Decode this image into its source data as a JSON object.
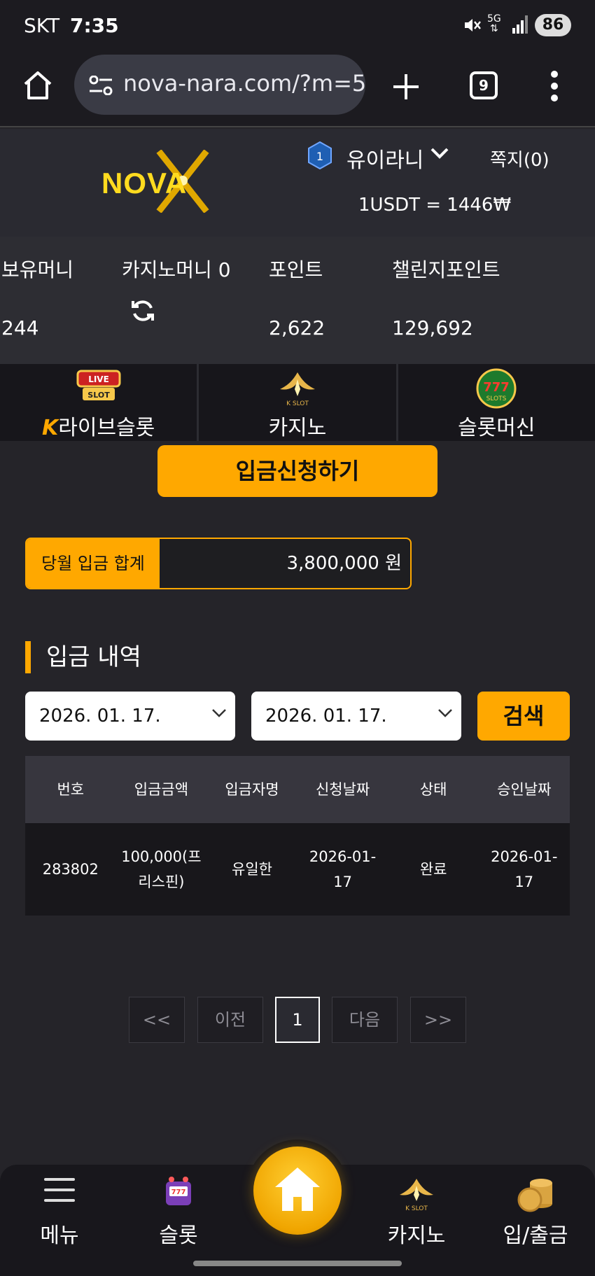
{
  "status_bar": {
    "carrier": "SKT",
    "time": "7:35",
    "network": "5G",
    "battery": "86"
  },
  "browser": {
    "url": "nova-nara.com/?m=5",
    "tab_count": "9"
  },
  "header": {
    "logo_text": "NOVA",
    "user_level": "1",
    "username": "유이라니",
    "messages_label": "쪽지(0)",
    "exchange_rate": "1USDT = 1446₩"
  },
  "balances": {
    "cash_label": "보유머니",
    "cash_value": "244",
    "casino_label": "카지노머니 0",
    "points_label": "포인트",
    "points_value": "2,622",
    "challenge_label": "챌린지포인트",
    "challenge_value": "129,692"
  },
  "game_tabs": [
    {
      "label": "라이브슬롯",
      "icon": "live-slot-icon"
    },
    {
      "label": "카지노",
      "icon": "k-slot-icon"
    },
    {
      "label": "슬롯머신",
      "icon": "777-slots-icon"
    }
  ],
  "deposit": {
    "request_button": "입금신청하기",
    "month_total_label": "당월 입금 합계",
    "month_total_value": "3,800,000 원"
  },
  "history": {
    "title": "입금 내역",
    "start_date": "2026. 01. 17.",
    "end_date": "2026. 01. 17.",
    "search_button": "검색",
    "columns": [
      "번호",
      "입금금액",
      "입금자명",
      "신청날짜",
      "상태",
      "승인날짜"
    ],
    "rows": [
      [
        "283802",
        "100,000(프리스핀)",
        "유일한",
        "2026-01-17",
        "완료",
        "2026-01-17"
      ]
    ]
  },
  "pagination": {
    "first": "<<",
    "prev": "이전",
    "current": "1",
    "next": "다음",
    "last": ">>"
  },
  "bottom_nav": {
    "menu": "메뉴",
    "slot": "슬롯",
    "casino": "카지노",
    "deposit": "입/출금"
  },
  "colors": {
    "accent": "#ffa800",
    "background": "#252429",
    "logo": "#ffdb1f"
  }
}
